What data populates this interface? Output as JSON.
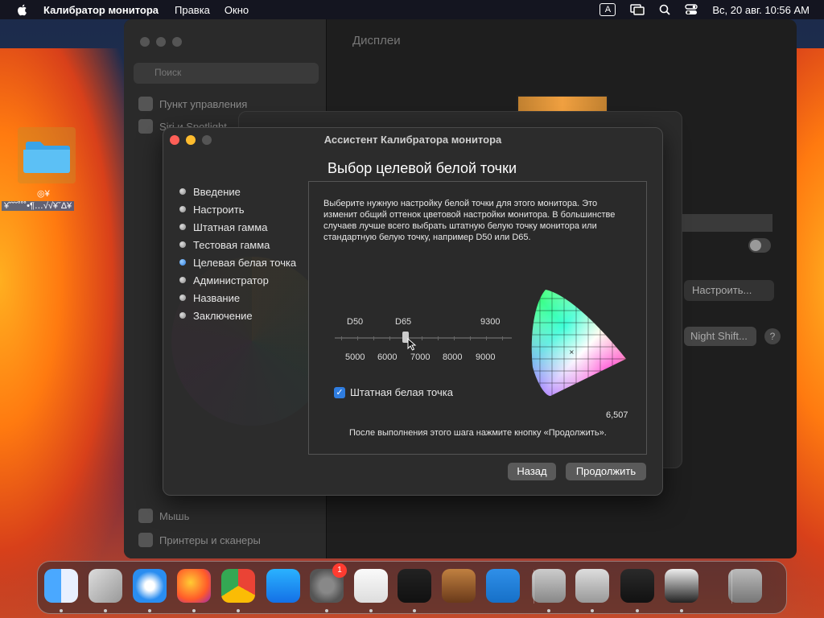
{
  "menubar": {
    "app_name": "Калибратор монитора",
    "items": [
      "Правка",
      "Окно"
    ],
    "input_indicator": "A",
    "datetime": "Вс, 20 авг. 10:56 AM"
  },
  "desktop": {
    "folder_label_line1": "◎¥",
    "folder_label_line2": "¥˘˘˘˚˚˚•¶…√√¥ˇΔ¥"
  },
  "settings_window": {
    "title": "Дисплеи",
    "search_placeholder": "Поиск",
    "sidebar_items": [
      "Пункт управления",
      "Siri и Spotlight",
      "Мышь",
      "Принтеры и сканеры"
    ],
    "configure_label": "Настроить...",
    "night_shift_label": "Night Shift...",
    "help_label": "?"
  },
  "calibrator": {
    "window_title": "Ассистент Калибратора монитора",
    "step_title": "Выбор целевой белой точки",
    "steps": [
      {
        "label": "Введение",
        "active": false
      },
      {
        "label": "Настроить",
        "active": false
      },
      {
        "label": "Штатная гамма",
        "active": false
      },
      {
        "label": "Тестовая гамма",
        "active": false
      },
      {
        "label": "Целевая белая точка",
        "active": true
      },
      {
        "label": "Администратор",
        "active": false
      },
      {
        "label": "Название",
        "active": false
      },
      {
        "label": "Заключение",
        "active": false
      }
    ],
    "description": "Выберите нужную настройку белой точки для этого монитора. Это изменит общий оттенок цветовой настройки монитора. В большинстве случаев лучше всего выбрать штатную белую точку монитора или стандартную белую точку, например D50 или D65.",
    "slider": {
      "labels_top": [
        "D50",
        "D65",
        "9300"
      ],
      "labels_bottom": [
        "5000",
        "6000",
        "7000",
        "8000",
        "9000"
      ],
      "value_fraction": 0.39
    },
    "native_white_point_label": "Штатная белая точка",
    "native_white_point_checked": true,
    "white_point_value": "6,507",
    "footer_note": "После выполнения этого шага нажмите кнопку «Продолжить».",
    "back_button": "Назад",
    "continue_button": "Продолжить"
  },
  "dock": {
    "apps": [
      "finder",
      "launchpad",
      "safari",
      "firefox",
      "chrome",
      "app-store",
      "system-settings",
      "textedit",
      "terminal",
      "garageband",
      "vscode",
      "disk-utility",
      "automator",
      "activity-monitor",
      "chrome-helper",
      "trash"
    ],
    "system_settings_badge": "1"
  }
}
